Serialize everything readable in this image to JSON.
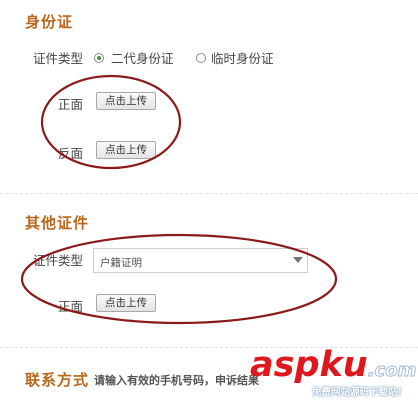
{
  "id_section": {
    "title": "身份证",
    "type_label": "证件类型",
    "options": [
      {
        "label": "二代身份证",
        "checked": true
      },
      {
        "label": "临时身份证",
        "checked": false
      }
    ],
    "front_label": "正面",
    "back_label": "反面",
    "upload_label": "点击上传"
  },
  "other_section": {
    "title": "其他证件",
    "type_label": "证件类型",
    "select_value": "户籍证明",
    "front_label": "正面",
    "upload_label": "点击上传"
  },
  "contact_section": {
    "title": "联系方式",
    "hint": "请输入有效的手机号码，申诉结果"
  },
  "watermark": {
    "brand": "aspku",
    "suffix": ".com",
    "tagline": "免费网站源码下载站！"
  },
  "colors": {
    "section_title": "#b8681e",
    "annotation_circle": "#8b1a1a",
    "watermark_red": "#e0181e"
  }
}
